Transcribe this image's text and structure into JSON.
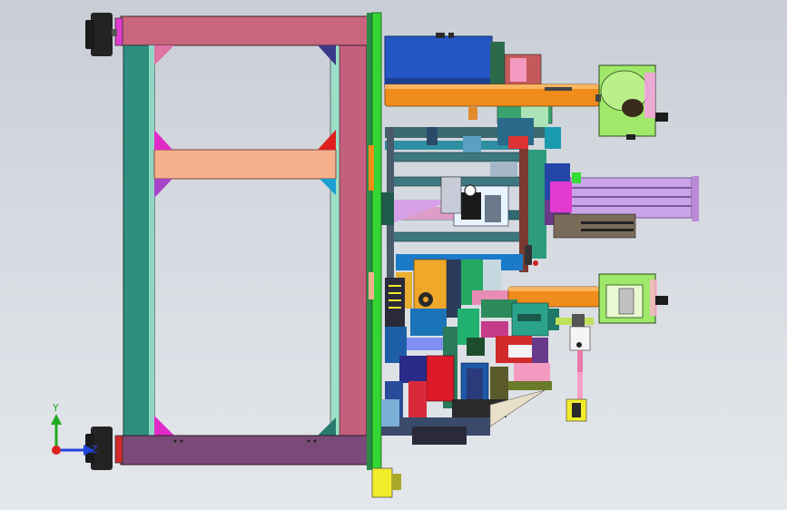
{
  "viewport": {
    "background_top": "#c9ced6",
    "background_bottom": "#e4e7eb"
  },
  "triad": {
    "y_label": "Y",
    "z_label": "Z",
    "y_color": "#22aa22",
    "z_color": "#2244dd",
    "x_color": "#dd2222"
  },
  "colors": {
    "frame_top": "#c9657c",
    "frame_post_left": "#2e8f80",
    "frame_post_right": "#c4607d",
    "frame_crossbar": "#f7b08e",
    "frame_bottom": "#7a4a78",
    "mount_plate": "#33d633",
    "motor_blue": "#2456c4",
    "orange_shaft": "#f08c1c",
    "housing_green": "#9fe86a",
    "cylinder_lilac": "#c9a4e8"
  }
}
